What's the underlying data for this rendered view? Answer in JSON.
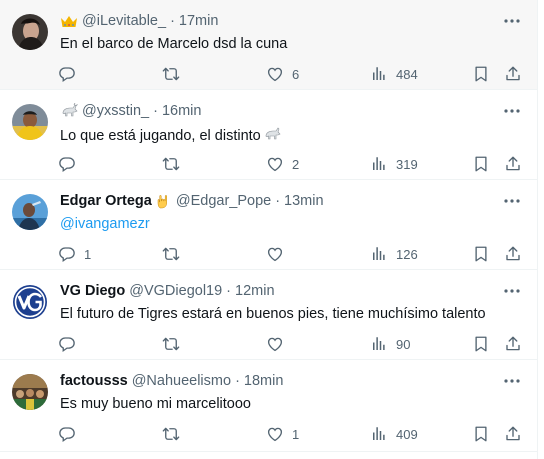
{
  "tweets": [
    {
      "name": "",
      "handle": "@iLevitable_",
      "time": "17min",
      "text": "En el barco de Marcelo dsd la cuna",
      "reply_count": "",
      "retweet_count": "",
      "like_count": "6",
      "view_count": "484"
    },
    {
      "name": "",
      "handle": "@yxsstin_",
      "time": "16min",
      "text": "Lo que está jugando, el distinto",
      "reply_count": "",
      "retweet_count": "",
      "like_count": "2",
      "view_count": "319"
    },
    {
      "name": "Edgar Ortega",
      "handle": "@Edgar_Pope",
      "time": "13min",
      "text": "@ivangamezr",
      "reply_count": "1",
      "retweet_count": "",
      "like_count": "",
      "view_count": "126"
    },
    {
      "name": "VG Diego",
      "handle": "@VGDiegol19",
      "time": "12min",
      "text": "El futuro de Tigres estará en buenos pies, tiene muchísimo talento",
      "reply_count": "",
      "retweet_count": "",
      "like_count": "",
      "view_count": "90"
    },
    {
      "name": "factousss",
      "handle": "@Nahueelismo",
      "time": "18min",
      "text": "Es muy bueno mi marcelitooo",
      "reply_count": "",
      "retweet_count": "",
      "like_count": "1",
      "view_count": "409"
    }
  ],
  "separator": "·",
  "colors": {
    "text_primary": "#0f1419",
    "text_secondary": "#536471",
    "mention": "#1d9bf0",
    "border": "#eff3f4",
    "highlight_bg": "#f7f7f7"
  },
  "icons": [
    "crown-icon",
    "goat-icon",
    "rock-hand-icon",
    "more-icon",
    "reply-icon",
    "retweet-icon",
    "like-icon",
    "views-icon",
    "bookmark-icon",
    "share-icon"
  ]
}
